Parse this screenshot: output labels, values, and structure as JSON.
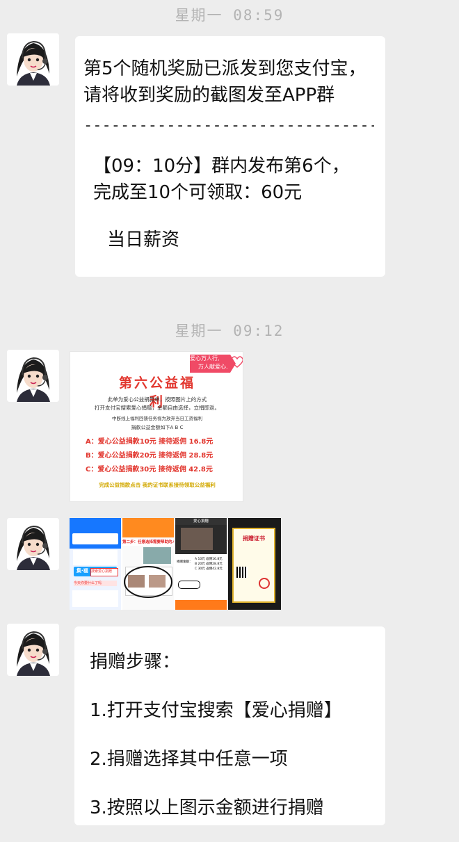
{
  "timestamps": [
    "星期一 08:59",
    "星期一 09:12"
  ],
  "message1": {
    "line1": "第5个随机奖励已派发到您支付宝，",
    "line2": "请将收到奖励的截图发至APP群",
    "divider": "----------------------------------",
    "line3": "【09：10分】群内发布第6个，",
    "line4": "完成至10个可领取：60元",
    "line5": "当日薪资"
  },
  "poster": {
    "title": "第六公益福利",
    "tag_top": "爱心万人行,",
    "tag_bottom": "万人献爱心.",
    "desc1": "此单为爱心公益捐款单，按照图片上的方式",
    "desc2": "打开支付宝搜索爱心捐赠，金额自由选择，立捐即返。",
    "desc3": "中断线上福利回馈任务视为放弃当日工资福利",
    "choice": "捐款公益金额如下A  B  C",
    "options": [
      "A：爱心公益捐款10元    接待返佣 16.8元",
      "B：爱心公益捐款20元    接待返佣 28.8元",
      "C：爱心公益捐款30元    接待返佣 42.8元"
    ],
    "footer": "完成公益捐款点击 我的证书联系接待领取公益福利"
  },
  "screenshots": {
    "shot1_banner": "集·福",
    "shot1_search": "搜索爱心捐赠",
    "shot1_promo": "今天你要什么了吗",
    "shot2_header": "第二步：任意选择需要帮助的人",
    "shot3_title": "爱心捐赠",
    "shot3_amounts": [
      "A 10元 返佣16.8元",
      "B 20元 返佣28.8元",
      "C 30元 返佣42.8元"
    ],
    "shot3_label": "捐赠金额：",
    "shot4_title": "捐赠证书"
  },
  "message2": {
    "steps": [
      "捐赠步骤：",
      "1.打开支付宝搜索【爱心捐赠】",
      "2.捐赠选择其中任意一项",
      "3.按照以上图示金额进行捐赠"
    ]
  },
  "colors": {
    "background": "#ededed",
    "bubble": "#ffffff",
    "poster_red": "#e2372f",
    "alipay_blue": "#1677ff"
  }
}
